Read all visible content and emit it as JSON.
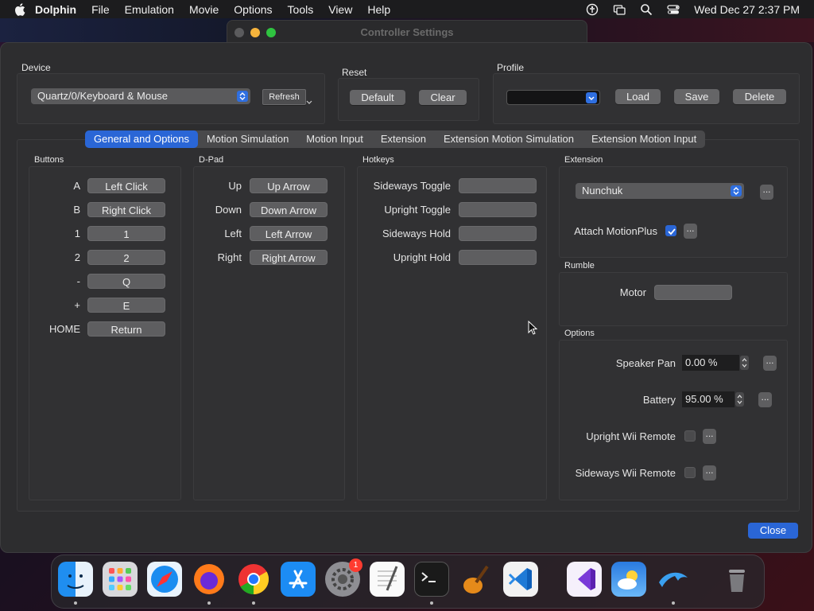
{
  "menubar": {
    "app": "Dolphin",
    "items": [
      "File",
      "Emulation",
      "Movie",
      "Options",
      "Tools",
      "View",
      "Help"
    ],
    "clock": "Wed Dec 27  2:37 PM"
  },
  "window": {
    "title": "Controller Settings",
    "device": {
      "label": "Device",
      "value": "Quartz/0/Keyboard & Mouse",
      "refresh": "Refresh"
    },
    "reset": {
      "label": "Reset",
      "default": "Default",
      "clear": "Clear"
    },
    "profile": {
      "label": "Profile",
      "value": "",
      "load": "Load",
      "save": "Save",
      "delete": "Delete"
    },
    "tabs": [
      "General and Options",
      "Motion Simulation",
      "Motion Input",
      "Extension",
      "Extension Motion Simulation",
      "Extension Motion Input"
    ],
    "buttons": {
      "label": "Buttons",
      "rows": [
        {
          "name": "A",
          "key": "Left Click"
        },
        {
          "name": "B",
          "key": "Right Click"
        },
        {
          "name": "1",
          "key": "1"
        },
        {
          "name": "2",
          "key": "2"
        },
        {
          "name": "-",
          "key": "Q"
        },
        {
          "name": "+",
          "key": "E"
        },
        {
          "name": "HOME",
          "key": "Return"
        }
      ]
    },
    "dpad": {
      "label": "D-Pad",
      "rows": [
        {
          "name": "Up",
          "key": "Up Arrow"
        },
        {
          "name": "Down",
          "key": "Down Arrow"
        },
        {
          "name": "Left",
          "key": "Left Arrow"
        },
        {
          "name": "Right",
          "key": "Right Arrow"
        }
      ]
    },
    "hotkeys": {
      "label": "Hotkeys",
      "rows": [
        {
          "name": "Sideways Toggle",
          "key": ""
        },
        {
          "name": "Upright Toggle",
          "key": ""
        },
        {
          "name": "Sideways Hold",
          "key": ""
        },
        {
          "name": "Upright Hold",
          "key": ""
        }
      ]
    },
    "extension": {
      "label": "Extension",
      "value": "Nunchuk",
      "motionplus_label": "Attach MotionPlus",
      "motionplus_checked": true,
      "dots": "..."
    },
    "rumble": {
      "label": "Rumble",
      "motor_label": "Motor",
      "motor_key": ""
    },
    "options": {
      "label": "Options",
      "speaker_pan_label": "Speaker Pan",
      "speaker_pan_value": "0.00 %",
      "battery_label": "Battery",
      "battery_value": "95.00 %",
      "upright_label": "Upright Wii Remote",
      "upright_checked": false,
      "sideways_label": "Sideways Wii Remote",
      "sideways_checked": false
    },
    "close": "Close"
  },
  "dock": {
    "apps": [
      "Finder",
      "Launchpad",
      "Safari",
      "Firefox",
      "Chrome",
      "App Store",
      "System Settings",
      "TextEdit",
      "Terminal",
      "GarageBand",
      "VS Code",
      "Visual Studio",
      "Weather",
      "Dolphin",
      "Trash"
    ],
    "settings_badge": "1"
  },
  "colors": {
    "accent": "#2a66d6",
    "window_bg": "#2d2d2f",
    "button_bg": "#656567"
  }
}
